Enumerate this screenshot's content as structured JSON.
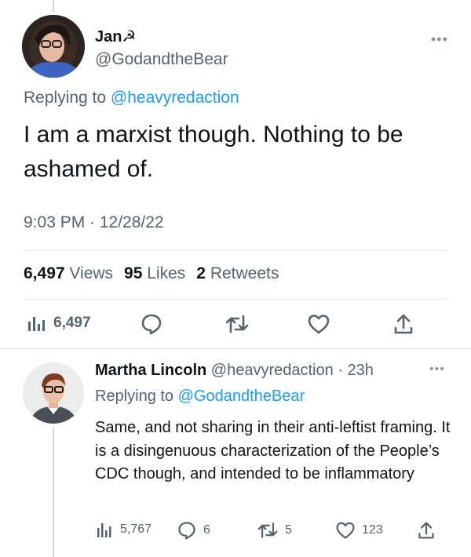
{
  "tweet": {
    "author_name": "Jan☭",
    "author_handle": "@GodandtheBear",
    "more_icon": "more-horizontal-icon",
    "replying_prefix": "Replying to",
    "replying_to": "@heavyredaction",
    "text": "I am a marxist though. Nothing to be ashamed of.",
    "timestamp": "9:03 PM · 12/28/22",
    "stats": {
      "views_count": "6,497",
      "views_label": "Views",
      "likes_count": "95",
      "likes_label": "Likes",
      "retweets_count": "2",
      "retweets_label": "Retweets"
    },
    "actions": {
      "views_count": "6,497",
      "views_icon": "analytics-icon",
      "reply_icon": "reply-icon",
      "retweet_icon": "retweet-icon",
      "like_icon": "heart-icon",
      "share_icon": "share-icon"
    }
  },
  "reply": {
    "author_name": "Martha Lincoln",
    "author_handle": "@heavyredaction",
    "time": "· 23h",
    "replying_prefix": "Replying to",
    "replying_to": "@GodandtheBear",
    "text": "Same, and not sharing in their anti-leftist framing. It is a disingenuous characterization of the People’s CDC though, and intended to be inflammatory",
    "actions": {
      "views_count": "5,767",
      "replies_count": "6",
      "retweets_count": "5",
      "likes_count": "123"
    }
  },
  "colors": {
    "text": "#0f1419",
    "secondary": "#536471",
    "link": "#1d9bf0",
    "divider": "#e6e9ec",
    "thread_line": "#cfd9de"
  }
}
